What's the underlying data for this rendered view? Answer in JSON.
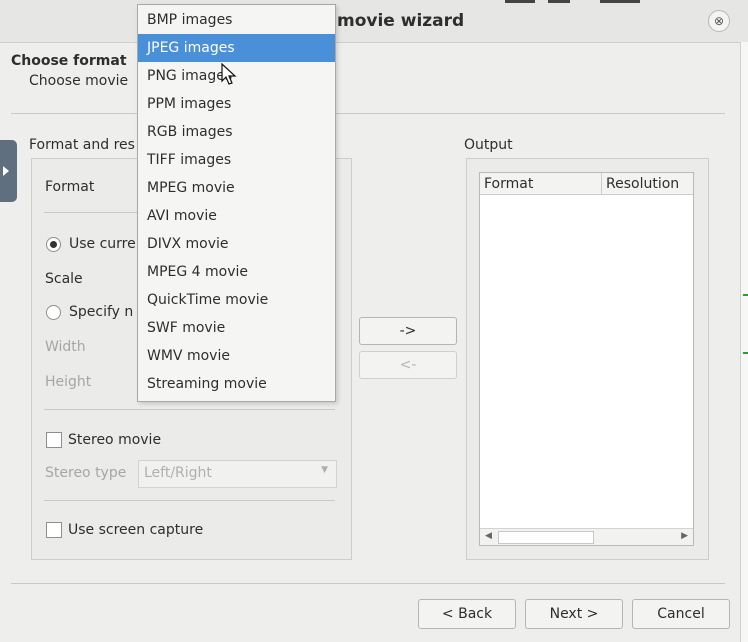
{
  "window": {
    "title": "movie wizard",
    "close_label": "⊗"
  },
  "step": {
    "title": "Choose format",
    "subtitle": "Choose movie"
  },
  "left_group": {
    "label": "Format and res",
    "format_label": "Format",
    "use_current_label": "Use curre",
    "scale_label": "Scale",
    "specify_label": "Specify n",
    "width_label": "Width",
    "height_label": "Height",
    "stereo_movie_label": "Stereo movie",
    "stereo_type_label": "Stereo type",
    "stereo_type_value": "Left/Right",
    "screen_capture_label": "Use screen capture"
  },
  "move_buttons": {
    "add": "->",
    "remove": "<-"
  },
  "output": {
    "label": "Output",
    "columns": [
      "Format",
      "Resolution"
    ]
  },
  "footer": {
    "back": "< Back",
    "next": "Next >",
    "cancel": "Cancel"
  },
  "format_menu": {
    "items": [
      "BMP  images",
      "JPEG images",
      "PNG  images",
      "PPM  images",
      "RGB  images",
      "TIFF images",
      "MPEG movie",
      "AVI movie",
      "DIVX movie",
      "MPEG 4 movie",
      "QuickTime movie",
      "SWF movie",
      "WMV movie",
      "Streaming movie"
    ],
    "selected": "JPEG images"
  },
  "colors": {
    "selection": "#4a90d9",
    "window_bg": "#eeeeec",
    "side_handle": "#5f6f80"
  },
  "icons": {
    "close": "close-icon",
    "side_handle": "expand-arrow-icon",
    "cursor": "mouse-pointer-icon"
  }
}
